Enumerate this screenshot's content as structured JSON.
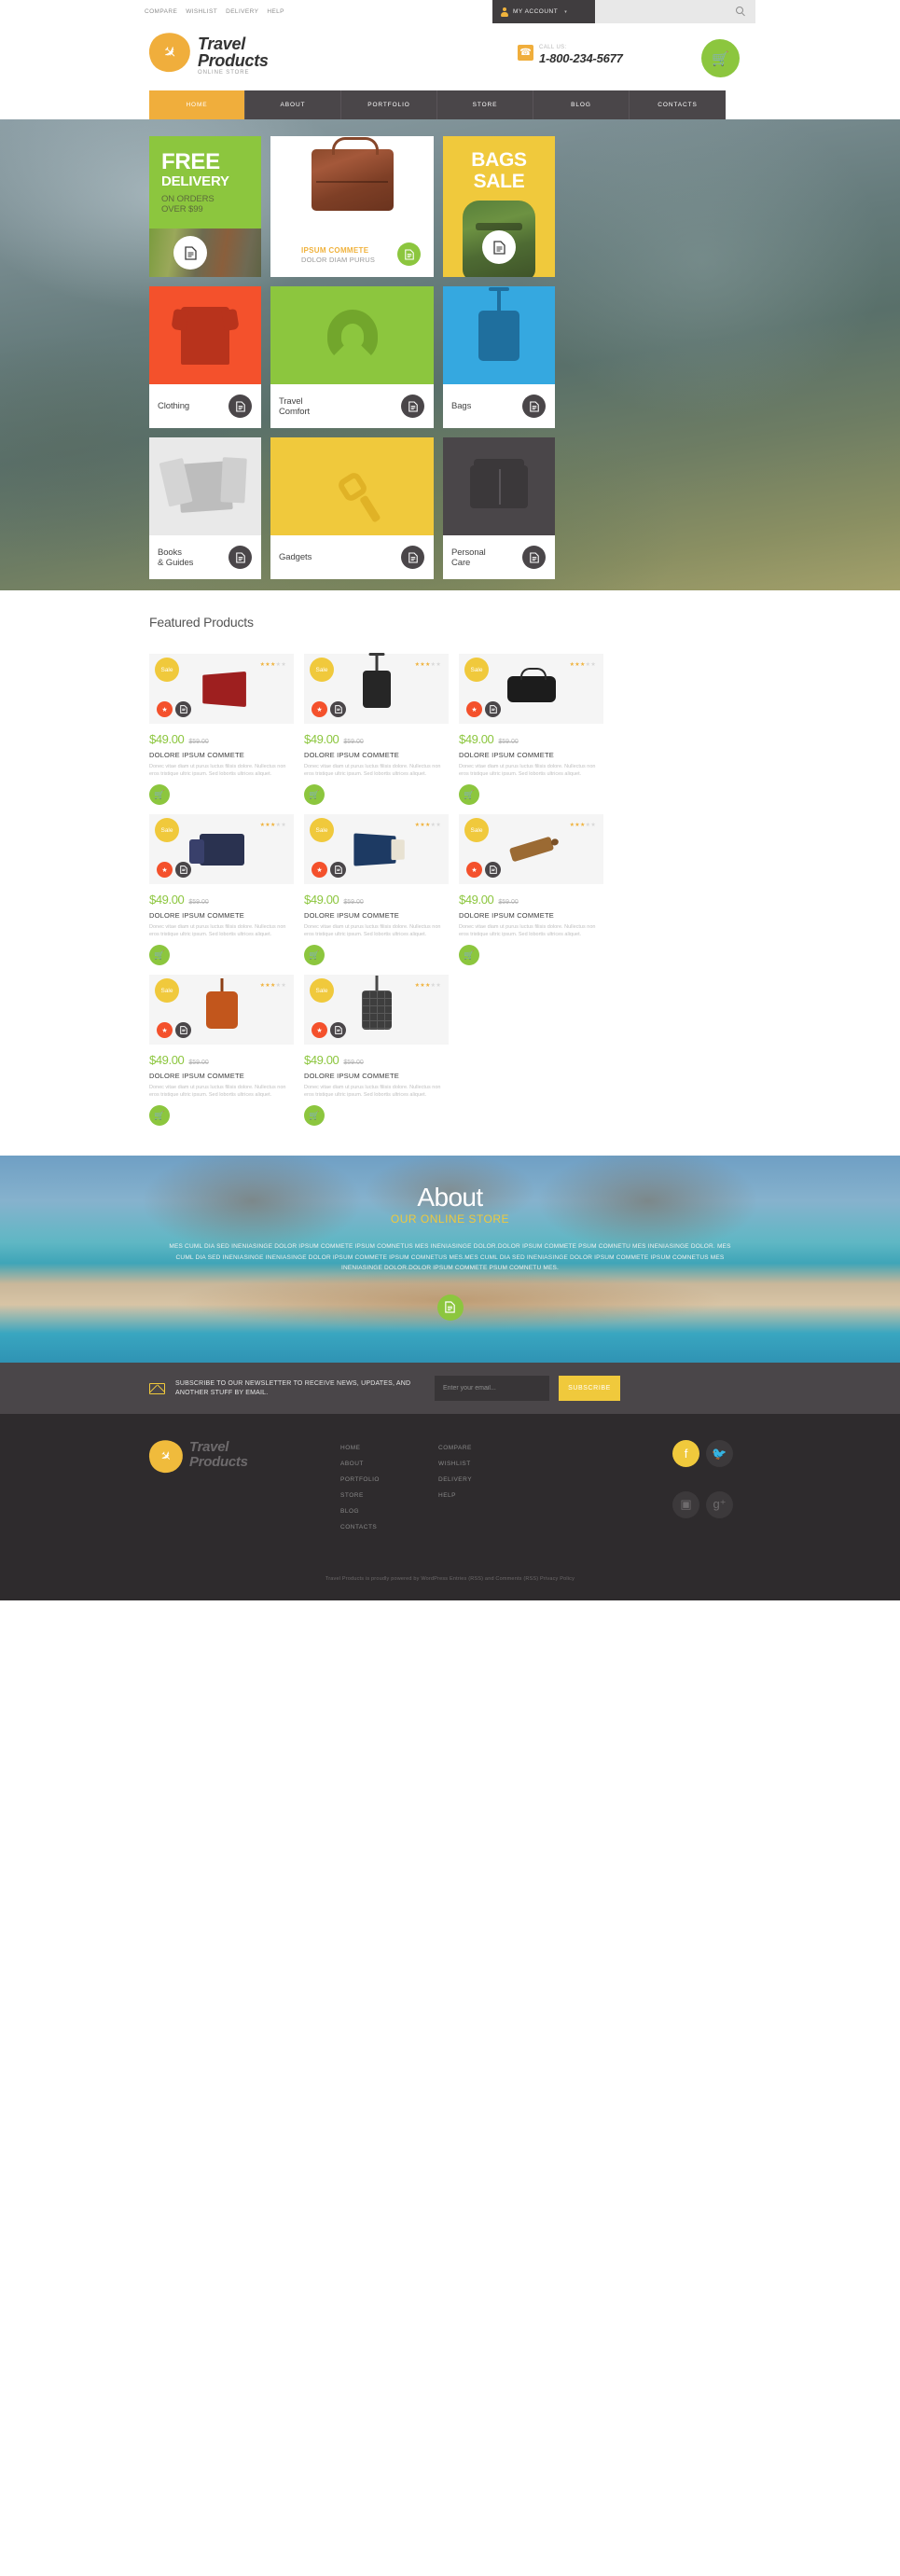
{
  "topbar": {
    "links": [
      "COMPARE",
      "WISHLIST",
      "DELIVERY",
      "HELP"
    ],
    "account_label": "MY ACCOUNT",
    "account_caret": "▾",
    "search_icon": "search-icon"
  },
  "header": {
    "logo": {
      "line1": "Travel",
      "line2": "Products",
      "tagline": "ONLINE STORE",
      "icon": "✈"
    },
    "call_label": "CALL US:",
    "phone": "1-800-234-5677",
    "phone_icon": "☎",
    "cart_icon": "🛒"
  },
  "nav": {
    "items": [
      {
        "label": "HOME",
        "active": true
      },
      {
        "label": "ABOUT",
        "active": false
      },
      {
        "label": "PORTFOLIO",
        "active": false
      },
      {
        "label": "STORE",
        "active": false
      },
      {
        "label": "BLOG",
        "active": false
      },
      {
        "label": "CONTACTS",
        "active": false
      }
    ]
  },
  "hero": {
    "promo_free": {
      "t1": "FREE",
      "t2": "DELIVERY",
      "t3": "ON ORDERS\nOVER $99"
    },
    "promo_center": {
      "title": "IPSUM COMMETE",
      "subtitle": "DOLOR DIAM PURUS"
    },
    "promo_bags": {
      "title": "BAGS\nSALE"
    },
    "categories": [
      {
        "name": "Clothing",
        "color": "red"
      },
      {
        "name": "Travel\nComfort",
        "color": "green"
      },
      {
        "name": "Bags",
        "color": "blue"
      },
      {
        "name": "Books\n& Guides",
        "color": "grey"
      },
      {
        "name": "Gadgets",
        "color": "yellow"
      },
      {
        "name": "Personal\nCare",
        "color": "dark"
      }
    ]
  },
  "featured": {
    "title": "Featured Products",
    "sale_badge": "Sale",
    "products": [
      {
        "price": "$49.00",
        "old_price": "$59.00",
        "name": "DOLORE IPSUM COMMETE",
        "desc": "Donec vitae diam ut purus luctus filisis dolore. Nullectus non eros tristique ultric ipsum. Sed lobortis ultrices aliquet.",
        "stars_on": 3,
        "stars_off": 2,
        "image": "wallet"
      },
      {
        "price": "$49.00",
        "old_price": "$59.00",
        "name": "DOLORE IPSUM COMMETE",
        "desc": "Donec vitae diam ut purus luctus filisis dolore. Nullectus non eros tristique ultric ipsum. Sed lobortis ultrices aliquet.",
        "stars_on": 3,
        "stars_off": 2,
        "image": "suitcase"
      },
      {
        "price": "$49.00",
        "old_price": "$59.00",
        "name": "DOLORE IPSUM COMMETE",
        "desc": "Donec vitae diam ut purus luctus filisis dolore. Nullectus non eros tristique ultric ipsum. Sed lobortis ultrices aliquet.",
        "stars_on": 3,
        "stars_off": 2,
        "image": "duffel"
      },
      {
        "price": "$49.00",
        "old_price": "$59.00",
        "name": "DOLORE IPSUM COMMETE",
        "desc": "Donec vitae diam ut purus luctus filisis dolore. Nullectus non eros tristique ultric ipsum. Sed lobortis ultrices aliquet.",
        "stars_on": 3,
        "stars_off": 2,
        "image": "set"
      },
      {
        "price": "$49.00",
        "old_price": "$59.00",
        "name": "DOLORE IPSUM COMMETE",
        "desc": "Donec vitae diam ut purus luctus filisis dolore. Nullectus non eros tristique ultric ipsum. Sed lobortis ultrices aliquet.",
        "stars_on": 3,
        "stars_off": 2,
        "image": "passport"
      },
      {
        "price": "$49.00",
        "old_price": "$59.00",
        "name": "DOLORE IPSUM COMMETE",
        "desc": "Donec vitae diam ut purus luctus filisis dolore. Nullectus non eros tristique ultric ipsum. Sed lobortis ultrices aliquet.",
        "stars_on": 3,
        "stars_off": 2,
        "image": "tag"
      },
      {
        "price": "$49.00",
        "old_price": "$59.00",
        "name": "DOLORE IPSUM COMMETE",
        "desc": "Donec vitae diam ut purus luctus filisis dolore. Nullectus non eros tristique ultric ipsum. Sed lobortis ultrices aliquet.",
        "stars_on": 3,
        "stars_off": 2,
        "image": "orange"
      },
      {
        "price": "$49.00",
        "old_price": "$59.00",
        "name": "DOLORE IPSUM COMMETE",
        "desc": "Donec vitae diam ut purus luctus filisis dolore. Nullectus non eros tristique ultric ipsum. Sed lobortis ultrices aliquet.",
        "stars_on": 3,
        "stars_off": 2,
        "image": "plaid"
      }
    ]
  },
  "about": {
    "title": "About",
    "subtitle": "OUR ONLINE STORE",
    "body": "MES CUML DIA SED INENIASINGE DOLOR IPSUM COMMETE IPSUM COMNETUS MES INENIASINGE DOLOR.DOLOR IPSUM COMMETE PSUM COMNETU MES INENIASINGE DOLOR. MES CUML DIA SED INENIASINGE INENIASINGE DOLOR IPSUM COMMETE IPSUM COMNETUS MES.MES CUML DIA SED INENIASINGE DOLOR IPSUM COMMETE IPSUM COMNETUS MES INENIASINGE DOLOR.DOLOR IPSUM COMMETE PSUM COMNETU MES."
  },
  "newsletter": {
    "text": "SUBSCRIBE TO OUR NEWSLETTER TO RECEIVE NEWS, UPDATES, AND ANOTHER STUFF BY EMAIL.",
    "placeholder": "Enter your email...",
    "button": "SUBSCRIBE"
  },
  "footer": {
    "logo": {
      "line1": "Travel",
      "line2": "Products",
      "icon": "✈"
    },
    "col1": [
      "HOME",
      "ABOUT",
      "PORTFOLIO",
      "STORE",
      "BLOG",
      "CONTACTS"
    ],
    "col2": [
      "COMPARE",
      "WISHLIST",
      "DELIVERY",
      "HELP"
    ],
    "socials": [
      {
        "name": "facebook",
        "glyph": "f"
      },
      {
        "name": "twitter",
        "glyph": "🐦"
      },
      {
        "name": "instagram",
        "glyph": "▣"
      },
      {
        "name": "google-plus",
        "glyph": "g⁺"
      }
    ],
    "copyright": "Travel Products is proudly powered by WordPress Entries (RSS) and Comments (RSS) Privacy Policy"
  },
  "colors": {
    "orange": "#f0ae3c",
    "yellow": "#f0c93c",
    "green": "#8cc63e",
    "red": "#f4512c",
    "blue": "#35a8e0",
    "dark": "#4a4649",
    "footer_bg": "#2e2b2d"
  }
}
